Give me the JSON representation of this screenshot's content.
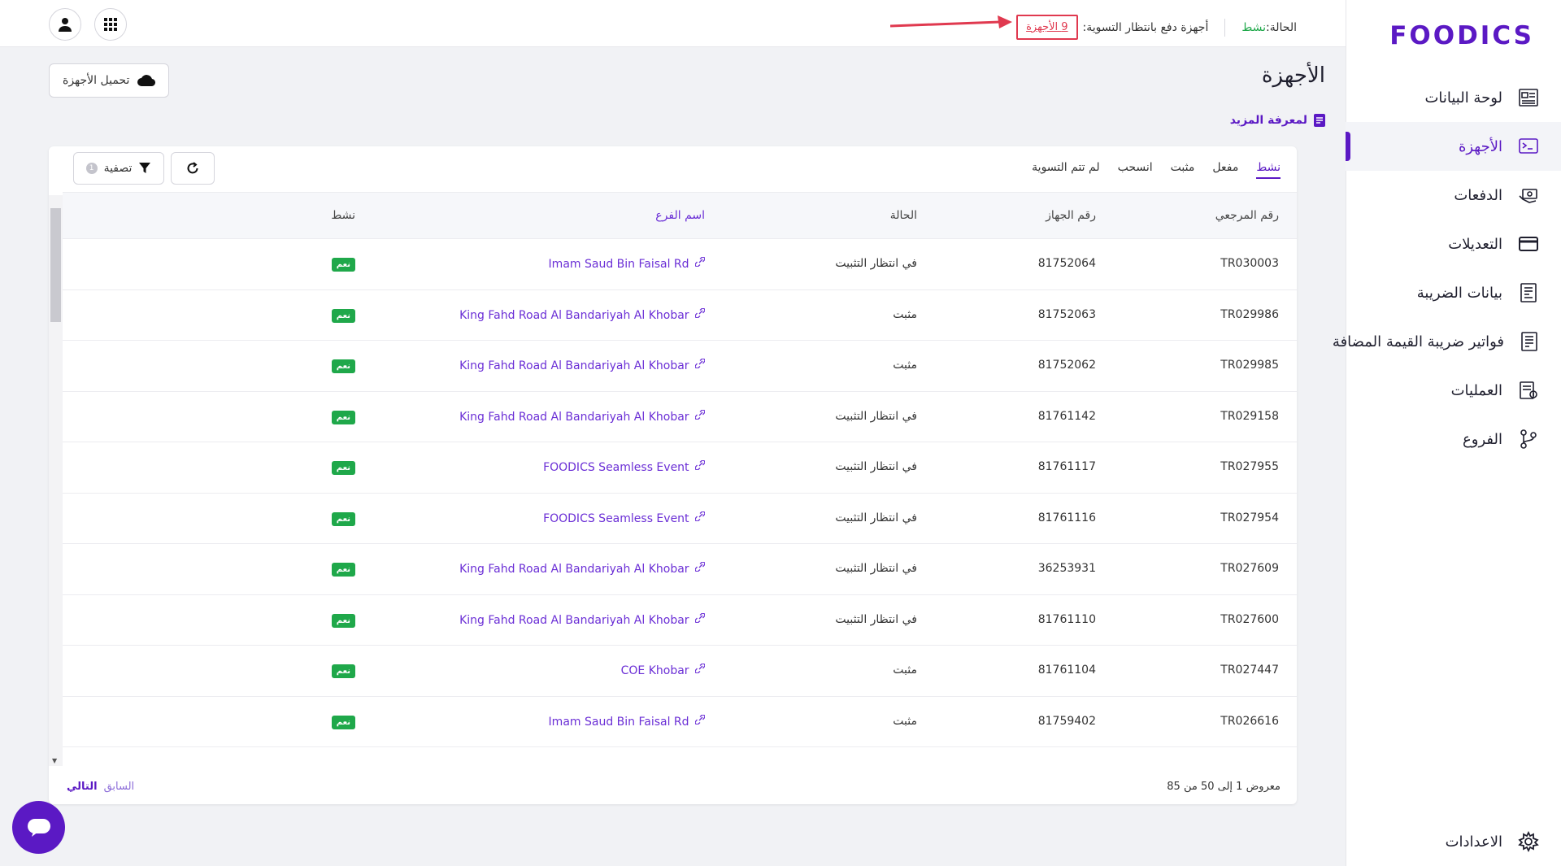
{
  "brand": {
    "logo_text": "FOODICS",
    "accent": "#5b19c4",
    "success": "#1fa84a",
    "alert": "#e0394f"
  },
  "sidebar": {
    "items": [
      {
        "label": "لوحة البيانات",
        "icon": "dashboard-icon"
      },
      {
        "label": "الأجهزة",
        "icon": "terminal-icon",
        "active": true
      },
      {
        "label": "الدفعات",
        "icon": "payments-icon"
      },
      {
        "label": "التعديلات",
        "icon": "card-icon"
      },
      {
        "label": "بيانات الضريبة",
        "icon": "tax-doc-icon"
      },
      {
        "label": "فواتير ضريبة القيمة المضافة",
        "icon": "invoice-icon"
      },
      {
        "label": "العمليات",
        "icon": "operations-icon"
      },
      {
        "label": "الفروع",
        "icon": "branches-icon"
      }
    ],
    "settings_label": "الاعدادات"
  },
  "topbar": {
    "status_label": "الحالة:",
    "status_value": "نشط",
    "pending_label": "أجهزة دفع بانتظار التسوية:",
    "pending_link": "9 الأجهزة"
  },
  "page": {
    "title": "الأجهزة",
    "learn_more": "لمعرفة المزيد",
    "upload_button": "تحميل الأجهزة"
  },
  "tabs": [
    "نشط",
    "مفعل",
    "مثبت",
    "انسحب",
    "لم تتم التسوية"
  ],
  "toolbar": {
    "filter_label": "تصفية",
    "filter_count": "1"
  },
  "table": {
    "headers": {
      "ref": "رقم المرجعي",
      "device": "رقم الجهاز",
      "state": "الحالة",
      "branch": "اسم الفرع",
      "active": "نشط"
    },
    "rows": [
      {
        "ref": "TR030003",
        "device": "81752064",
        "state": "في انتظار التثبيت",
        "branch": "Imam Saud Bin Faisal Rd",
        "active": "نعم"
      },
      {
        "ref": "TR029986",
        "device": "81752063",
        "state": "مثبت",
        "branch": "King Fahd Road Al Bandariyah Al Khobar",
        "active": "نعم"
      },
      {
        "ref": "TR029985",
        "device": "81752062",
        "state": "مثبت",
        "branch": "King Fahd Road Al Bandariyah Al Khobar",
        "active": "نعم"
      },
      {
        "ref": "TR029158",
        "device": "81761142",
        "state": "في انتظار التثبيت",
        "branch": "King Fahd Road Al Bandariyah Al Khobar",
        "active": "نعم"
      },
      {
        "ref": "TR027955",
        "device": "81761117",
        "state": "في انتظار التثبيت",
        "branch": "FOODICS Seamless Event",
        "active": "نعم"
      },
      {
        "ref": "TR027954",
        "device": "81761116",
        "state": "في انتظار التثبيت",
        "branch": "FOODICS Seamless Event",
        "active": "نعم"
      },
      {
        "ref": "TR027609",
        "device": "36253931",
        "state": "في انتظار التثبيت",
        "branch": "King Fahd Road Al Bandariyah Al Khobar",
        "active": "نعم"
      },
      {
        "ref": "TR027600",
        "device": "81761110",
        "state": "في انتظار التثبيت",
        "branch": "King Fahd Road Al Bandariyah Al Khobar",
        "active": "نعم"
      },
      {
        "ref": "TR027447",
        "device": "81761104",
        "state": "مثبت",
        "branch": "COE Khobar",
        "active": "نعم"
      },
      {
        "ref": "TR026616",
        "device": "81759402",
        "state": "مثبت",
        "branch": "Imam Saud Bin Faisal Rd",
        "active": "نعم"
      }
    ]
  },
  "footer": {
    "summary": "معروض 1 إلى 50 من 85",
    "prev": "السابق",
    "next": "التالي"
  }
}
